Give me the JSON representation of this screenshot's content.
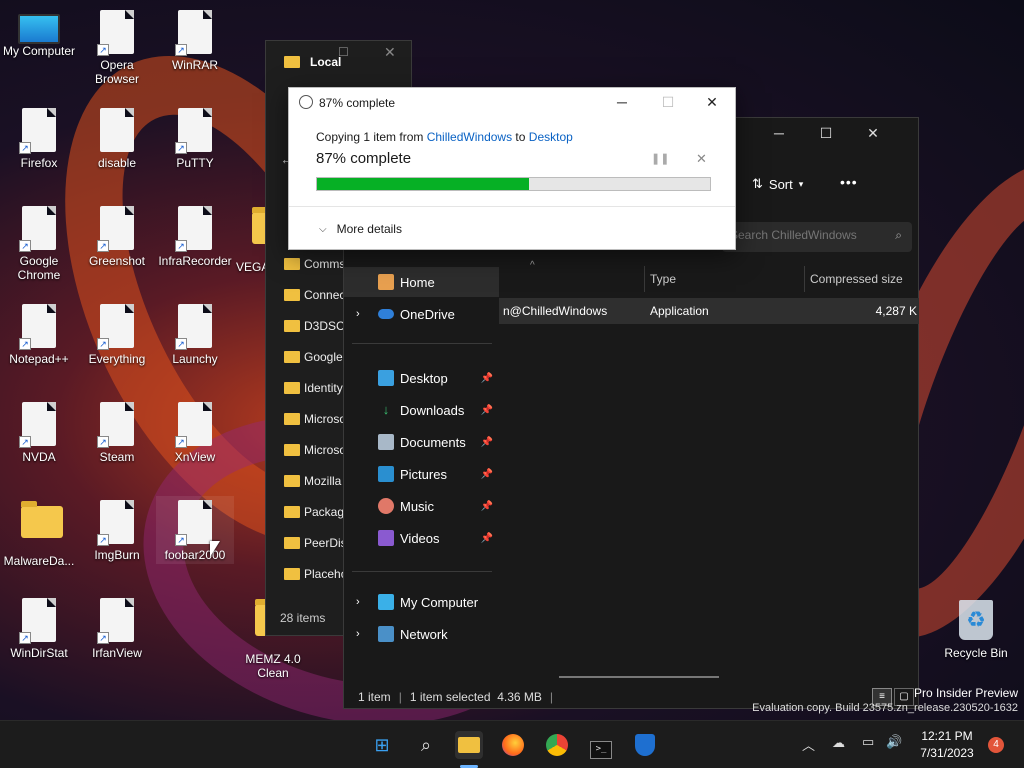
{
  "desktop": {
    "icons": [
      {
        "label": "My Computer"
      },
      {
        "label": "Opera Browser"
      },
      {
        "label": "WinRAR"
      },
      {
        "label": "Firefox"
      },
      {
        "label": "disable"
      },
      {
        "label": "PuTTY"
      },
      {
        "label": "Google Chrome"
      },
      {
        "label": "Greenshot"
      },
      {
        "label": "InfraRecorder"
      },
      {
        "label": "VEGA"
      },
      {
        "label": "Notepad++"
      },
      {
        "label": "Everything"
      },
      {
        "label": "Launchy"
      },
      {
        "label": "NVDA"
      },
      {
        "label": "Steam"
      },
      {
        "label": "XnView"
      },
      {
        "label": "MalwareDa..."
      },
      {
        "label": "ImgBurn"
      },
      {
        "label": "foobar2000"
      },
      {
        "label": "WinDirStat"
      },
      {
        "label": "IrfanView"
      },
      {
        "label": "MEMZ 4.0 Clean"
      },
      {
        "label": "Recycle Bin"
      }
    ],
    "watermark_line1": "Pro Insider Preview",
    "watermark_line2": "Evaluation copy. Build 23575.zn_release.230520-1632"
  },
  "back_window": {
    "title": "Local",
    "folders": [
      "Comms",
      "Connec",
      "D3DSCa",
      "Google",
      "Identity",
      "Microso",
      "Microso",
      "Mozilla",
      "Packag",
      "PeerDis",
      "Placeho"
    ],
    "status": "28 items"
  },
  "explorer": {
    "sort_label": "Sort",
    "more_label": "•••",
    "search_placeholder": "Search ChilledWindows",
    "columns": {
      "type": "Type",
      "compressed": "Compressed size"
    },
    "row": {
      "name": "n@ChilledWindows",
      "type": "Application",
      "compressed": "4,287 K"
    },
    "nav": {
      "home": "Home",
      "onedrive": "OneDrive",
      "desktop": "Desktop",
      "downloads": "Downloads",
      "documents": "Documents",
      "pictures": "Pictures",
      "music": "Music",
      "videos": "Videos",
      "my_computer": "My Computer",
      "network": "Network"
    },
    "status": {
      "count": "1 item",
      "selected": "1 item selected  4.36 MB"
    }
  },
  "dialog": {
    "title": "87% complete",
    "copy_prefix": "Copying 1 item from ",
    "source": "ChilledWindows",
    "to": " to ",
    "dest": "Desktop",
    "progress_text": "87% complete",
    "progress": 0.54,
    "more_details": "More details",
    "progress_color": "#06b025"
  },
  "taskbar": {
    "time": "12:21 PM",
    "date": "7/31/2023",
    "notification_count": "4"
  }
}
